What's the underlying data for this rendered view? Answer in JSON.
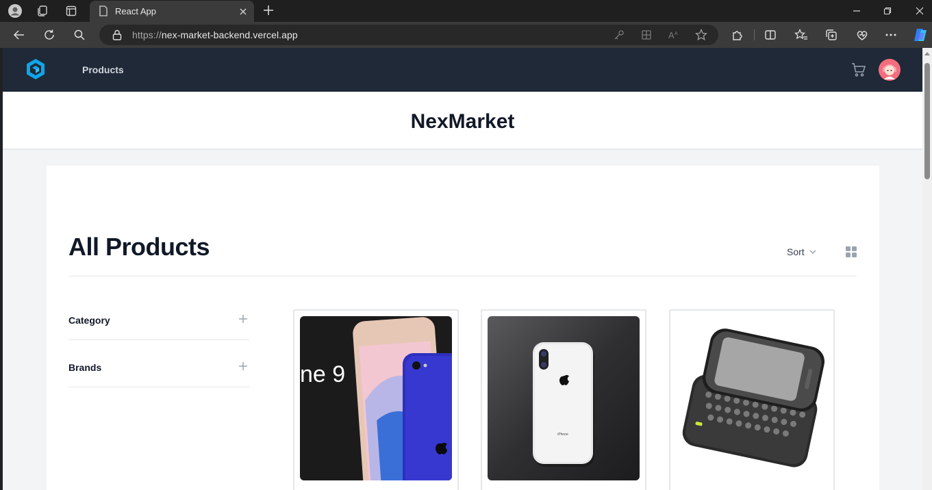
{
  "browser": {
    "tab_title": "React App",
    "url_protocol": "https://",
    "url_host": "nex-market-backend.vercel.app"
  },
  "app": {
    "nav_link": "Products",
    "site_title": "NexMarket",
    "page_heading": "All Products",
    "sort_label": "Sort",
    "filters": [
      {
        "label": "Category"
      },
      {
        "label": "Brands"
      }
    ],
    "products": [
      {
        "image": "iphone-9-promo"
      },
      {
        "image": "iphone-x-white-back"
      },
      {
        "image": "slider-qwerty-phone"
      }
    ],
    "accent_color": "#1f2937",
    "logo_color": "#0ea5e9"
  },
  "product_image_text": {
    "promo_text": "ne 9",
    "phone_label": "iPhone"
  }
}
